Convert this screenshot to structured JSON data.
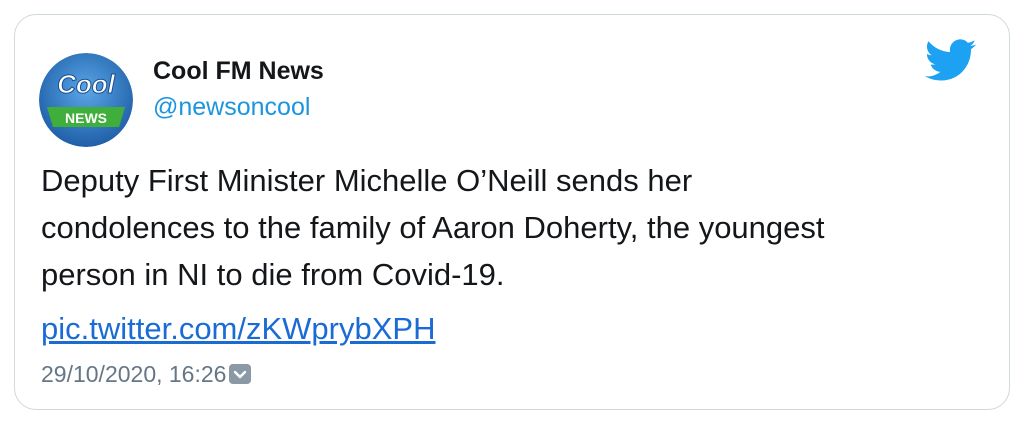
{
  "author": {
    "name": "Cool FM News",
    "handle": "@newsoncool",
    "avatar_top_text": "Cool",
    "avatar_badge_text": "NEWS"
  },
  "tweet": {
    "lines": [
      "Deputy First Minister Michelle O’Neill sends her",
      "condolences to the family of Aaron Doherty, the youngest",
      "person in NI to die from Covid-19."
    ],
    "link": "pic.twitter.com/zKWprybXPH",
    "timestamp": "29/10/2020, 16:26"
  },
  "icons": {
    "brand": "twitter-bird-icon",
    "menu": "chevron-down-icon"
  },
  "colors": {
    "brand": "#1da1f2",
    "link": "#1b6bd6",
    "handle": "#1b95e0",
    "muted": "#657786"
  }
}
